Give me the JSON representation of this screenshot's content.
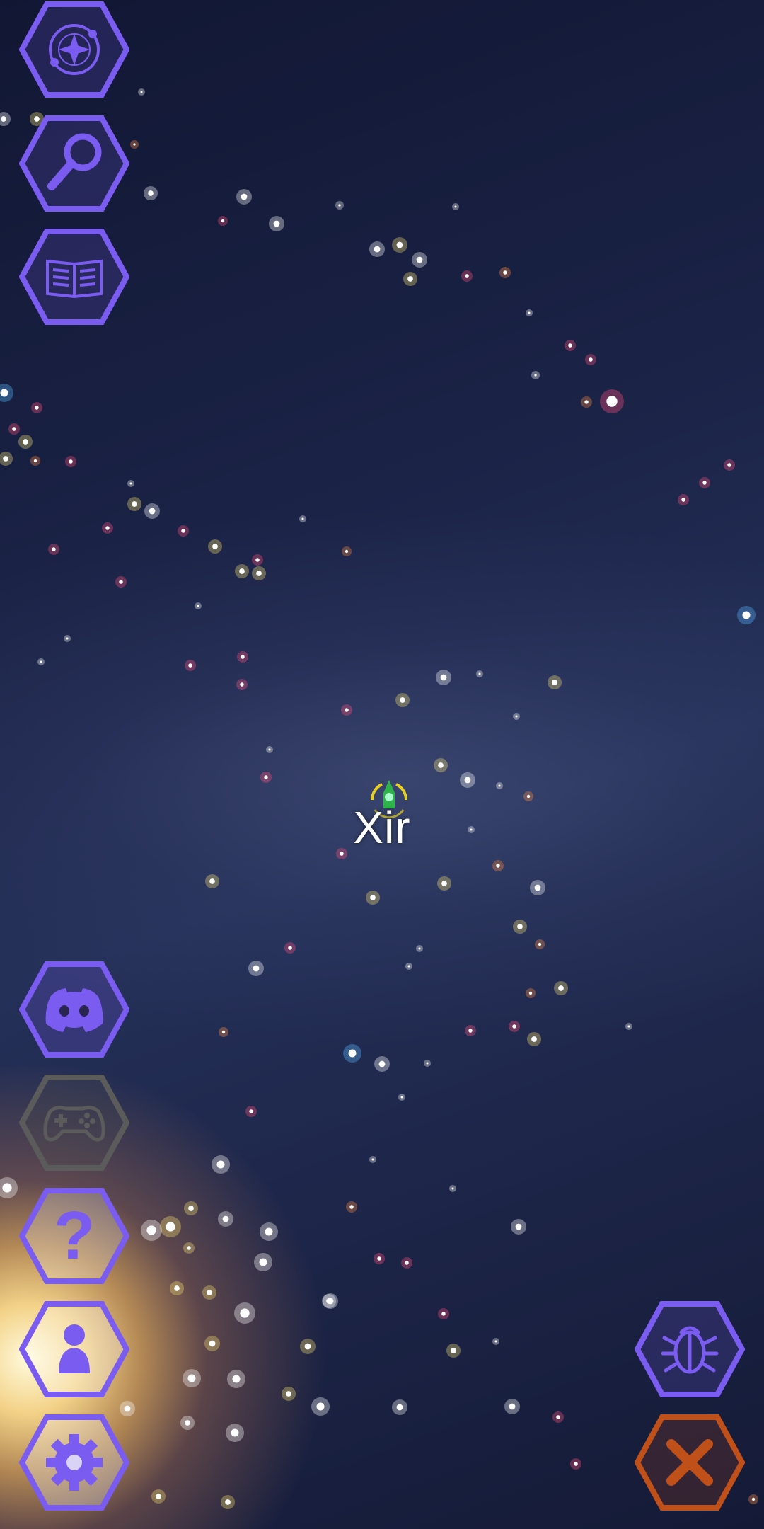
{
  "selected_star": {
    "name": "Xir"
  },
  "colors": {
    "hex_purple": "#7b5cf0",
    "hex_gray": "#5b5b5b",
    "hex_orange": "#c0501a",
    "ship_green": "#2db34a",
    "ring_yellow": "#e8d020"
  },
  "left_top_buttons": [
    {
      "icon": "galaxy-map-icon"
    },
    {
      "icon": "search-icon"
    },
    {
      "icon": "encyclopedia-book-icon"
    }
  ],
  "left_bottom_buttons": [
    {
      "icon": "discord-icon"
    },
    {
      "icon": "gamepad-icon"
    },
    {
      "icon": "help-icon",
      "glyph": "?"
    },
    {
      "icon": "profile-icon"
    },
    {
      "icon": "settings-gear-icon"
    }
  ],
  "right_bottom_buttons": [
    {
      "icon": "bug-report-icon"
    },
    {
      "icon": "close-icon"
    }
  ]
}
